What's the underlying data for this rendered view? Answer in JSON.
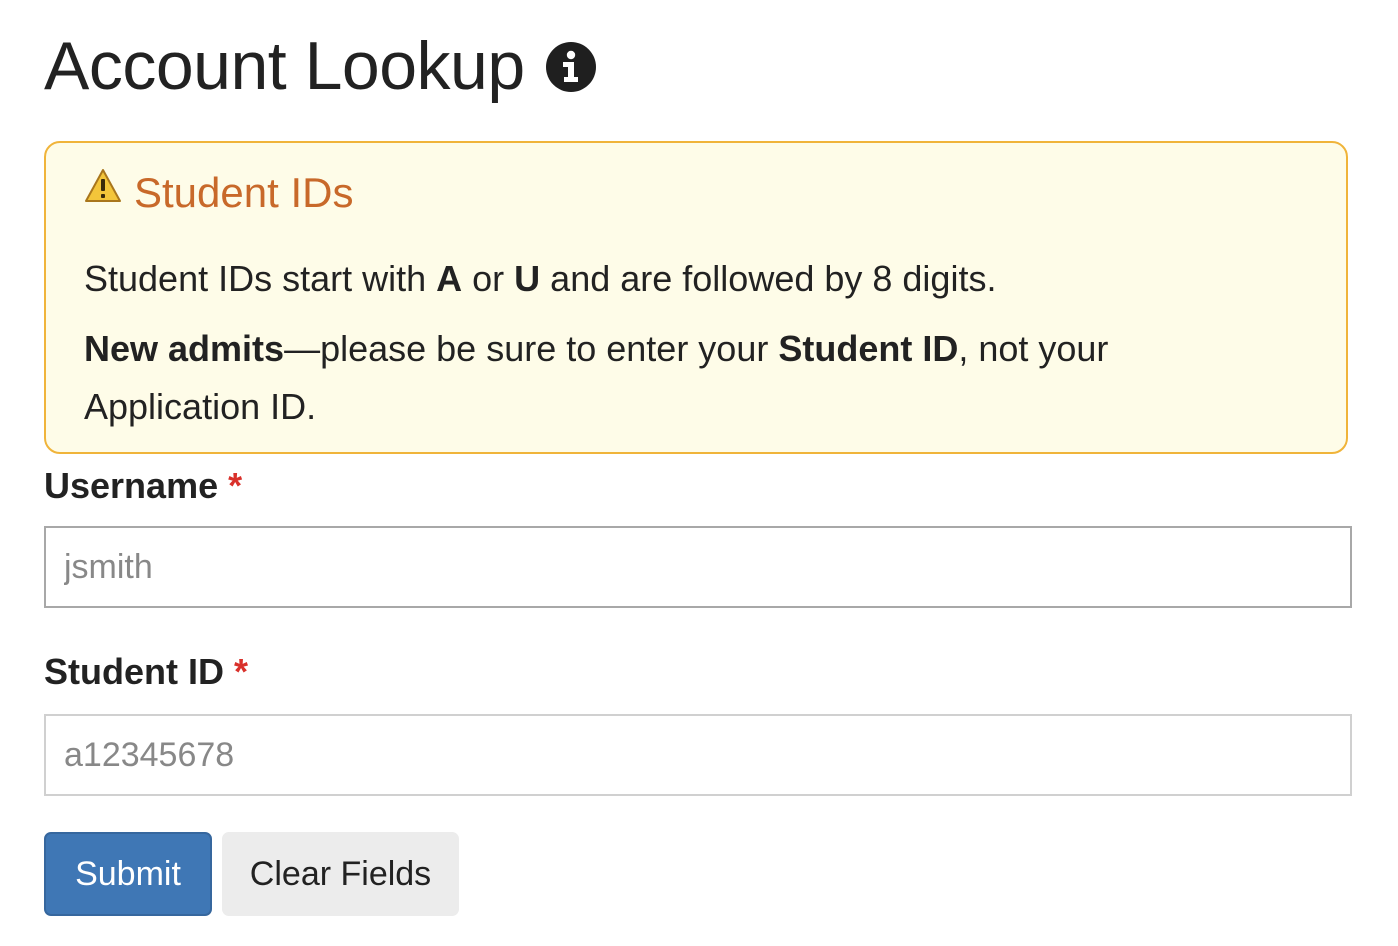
{
  "header": {
    "title": "Account Lookup",
    "info_icon": "info-circle-icon"
  },
  "alert": {
    "icon": "warning-triangle-icon",
    "title": "Student IDs",
    "line1": {
      "t1": "Student IDs start with ",
      "b1": "A",
      "t2": " or ",
      "b2": "U",
      "t3": " and are followed by 8 digits."
    },
    "line2": {
      "b1": "New admits",
      "t1": "—please be sure to enter your ",
      "b2": "Student ID",
      "t2": ", not your"
    },
    "line3": "Application ID.",
    "colors": {
      "background": "#fefce8",
      "border": "#f0b43a",
      "title": "#c8692a"
    }
  },
  "form": {
    "username": {
      "label": "Username",
      "required_mark": "*",
      "placeholder": "jsmith",
      "value": ""
    },
    "student_id": {
      "label": "Student ID",
      "required_mark": "*",
      "placeholder": "a12345678",
      "value": ""
    },
    "buttons": {
      "submit": "Submit",
      "clear": "Clear Fields"
    },
    "colors": {
      "submit_bg": "#3f77b5",
      "clear_bg": "#ececec",
      "required": "#d9312b"
    }
  }
}
